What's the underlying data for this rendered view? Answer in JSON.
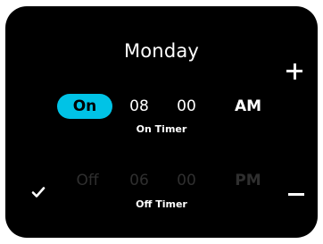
{
  "day": "Monday",
  "controls": {
    "increase_label": "+",
    "decrease_label": "−"
  },
  "on_timer": {
    "state": "On",
    "hour": "08",
    "minute": "00",
    "period": "AM",
    "caption": "On Timer",
    "active": true
  },
  "off_timer": {
    "state": "Off",
    "hour": "06",
    "minute": "00",
    "period": "PM",
    "caption": "Off Timer",
    "active": false,
    "checked": true
  },
  "colors": {
    "panel_bg": "#000000",
    "accent": "#00c3e6",
    "text": "#ffffff",
    "dim_text": "#2f2f2f"
  },
  "icons": {
    "increase": "plus-icon",
    "decrease": "minus-icon",
    "enabled": "checkmark-icon"
  }
}
